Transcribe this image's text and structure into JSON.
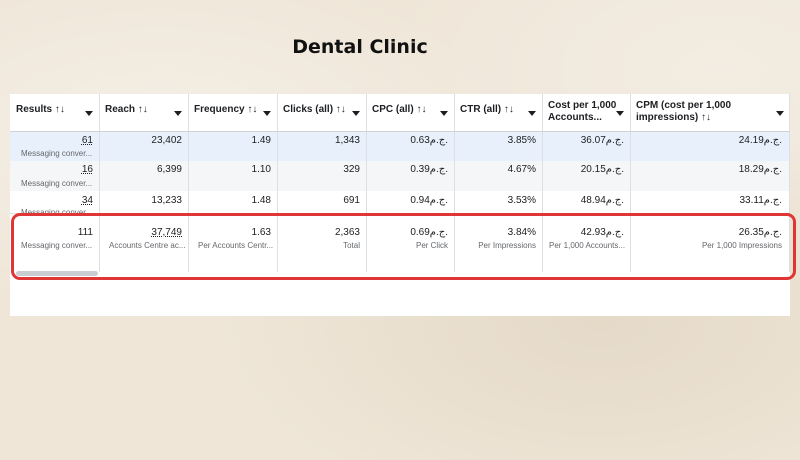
{
  "page_title": "Dental Clinic",
  "headers": [
    {
      "label": "Results ↑↓"
    },
    {
      "label": "Reach ↑↓"
    },
    {
      "label": "Frequency ↑↓"
    },
    {
      "label": "Clicks (all) ↑↓"
    },
    {
      "label": "CPC (all) ↑↓"
    },
    {
      "label": "CTR (all) ↑↓"
    },
    {
      "label": "Cost per 1,000 Accounts..."
    },
    {
      "label": "CPM (cost per 1,000 impressions) ↑↓"
    }
  ],
  "rows": [
    {
      "results": "61",
      "results_sub": "Messaging conver...",
      "reach": "23,402",
      "frequency": "1.49",
      "clicks": "1,343",
      "cpc": "0.63ج.م.",
      "ctr": "3.85%",
      "cost_accounts": "36.07ج.م.",
      "cpm": "24.19ج.م."
    },
    {
      "results": "16",
      "results_sub": "Messaging conver...",
      "reach": "6,399",
      "frequency": "1.10",
      "clicks": "329",
      "cpc": "0.39ج.م.",
      "ctr": "4.67%",
      "cost_accounts": "20.15ج.م.",
      "cpm": "18.29ج.م."
    },
    {
      "results": "34",
      "results_sub": "Messaging conver...",
      "reach": "13,233",
      "frequency": "1.48",
      "clicks": "691",
      "cpc": "0.94ج.م.",
      "ctr": "3.53%",
      "cost_accounts": "48.94ج.م.",
      "cpm": "33.11ج.م."
    }
  ],
  "totals": {
    "results": "111",
    "results_sub": "Messaging conver...",
    "reach": "37,749",
    "reach_sub": "Accounts Centre ac...",
    "frequency": "1.63",
    "frequency_sub": "Per Accounts Centr...",
    "clicks": "2,363",
    "clicks_sub": "Total",
    "cpc": "0.69ج.م.",
    "cpc_sub": "Per Click",
    "ctr": "3.84%",
    "ctr_sub": "Per Impressions",
    "cost_accounts": "42.93ج.م.",
    "cost_accounts_sub": "Per 1,000 Accounts...",
    "cpm": "26.35ج.م.",
    "cpm_sub": "Per 1,000 Impressions"
  },
  "colors": {
    "highlight_border": "#e03535",
    "selected_row": "#e8f1fb"
  }
}
